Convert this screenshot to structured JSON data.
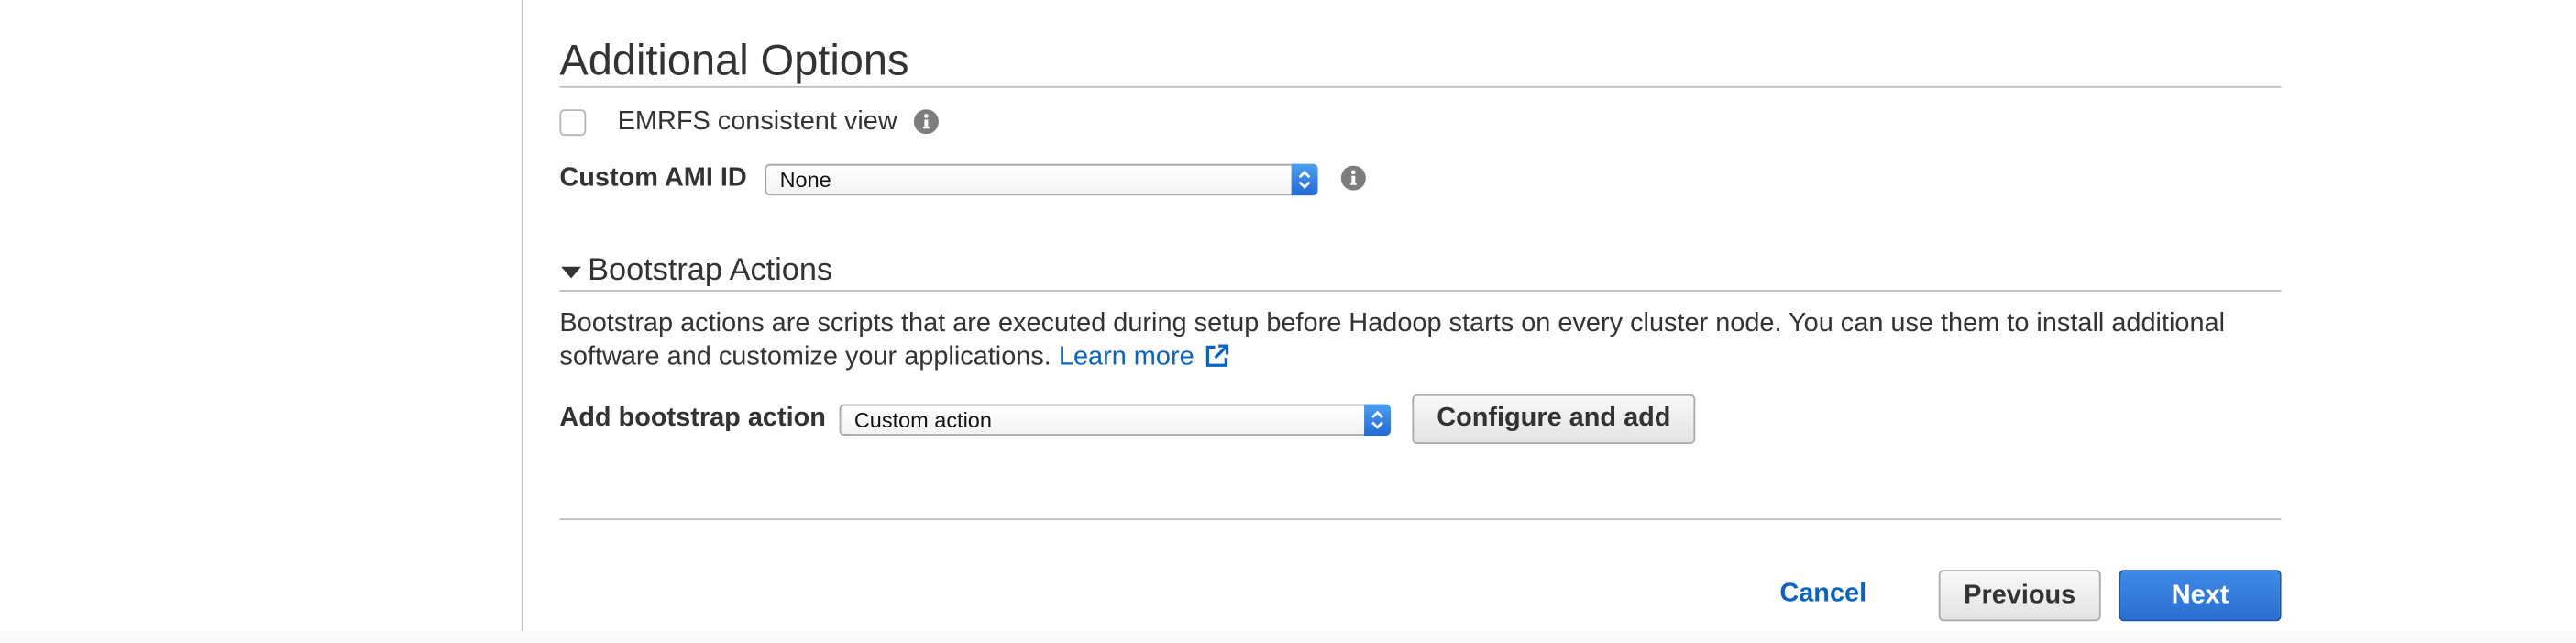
{
  "additional_options": {
    "title": "Additional Options",
    "emrfs_label": "EMRFS consistent view",
    "emrfs_checked": false,
    "custom_ami_label": "Custom AMI ID",
    "custom_ami_value": "None"
  },
  "bootstrap": {
    "section_title": "Bootstrap Actions",
    "description": "Bootstrap actions are scripts that are executed during setup before Hadoop starts on every cluster node. You can use them to install additional software and customize your applications.",
    "learn_more": "Learn more",
    "add_label": "Add bootstrap action",
    "add_value": "Custom action",
    "configure_button": "Configure and add"
  },
  "footer": {
    "cancel": "Cancel",
    "previous": "Previous",
    "next": "Next"
  },
  "icons": {
    "info": "info-icon",
    "caret": "caret-down-icon",
    "external": "external-link-icon",
    "spinner": "select-arrows-icon"
  },
  "colors": {
    "accent_blue": "#2a6fd0",
    "link_blue": "#0a63c4",
    "text": "#333333"
  }
}
